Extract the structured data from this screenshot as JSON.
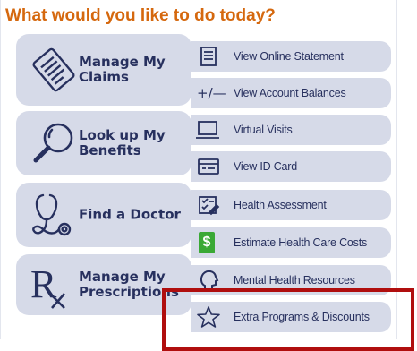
{
  "heading": "What would you like to do today?",
  "tiles": [
    {
      "label": "Manage My\nClaims",
      "icon": "document-list-icon"
    },
    {
      "label": "Look up My\nBenefits",
      "icon": "magnifying-glass-icon"
    },
    {
      "label": "Find a Doctor",
      "icon": "stethoscope-icon"
    },
    {
      "label": "Manage My\nPrescriptions",
      "icon": "rx-icon"
    }
  ],
  "links": [
    {
      "label": "View Online Statement",
      "icon": "statement-icon"
    },
    {
      "label": "View Account Balances",
      "icon": "plus-minus-icon"
    },
    {
      "label": "Virtual Visits",
      "icon": "laptop-icon"
    },
    {
      "label": "View ID Card",
      "icon": "id-card-icon"
    },
    {
      "label": "Health Assessment",
      "icon": "checklist-icon"
    },
    {
      "label": "Estimate Health Care Costs",
      "icon": "dollar-icon"
    },
    {
      "label": "Mental Health Resources",
      "icon": "head-profile-icon"
    },
    {
      "label": "Extra Programs & Discounts",
      "icon": "star-icon"
    }
  ],
  "colors": {
    "heading": "#d5680e",
    "tile_background": "#d6dae8",
    "text": "#27305e",
    "dollar_badge": "#3aa935",
    "highlight_box": "#b00e0e"
  },
  "plus_minus_glyph": "+/—",
  "dollar_glyph": "$",
  "rx_glyph": "R"
}
